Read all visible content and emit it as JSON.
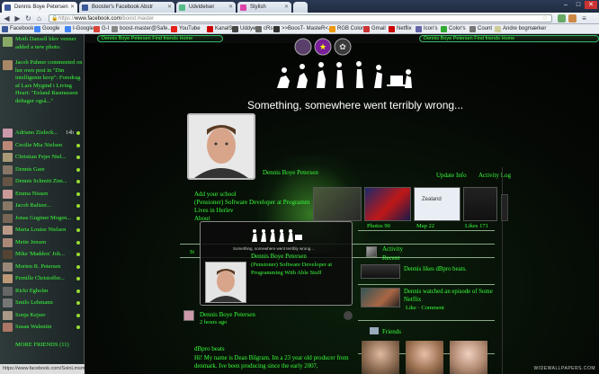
{
  "browser": {
    "tabs": [
      {
        "label": "Dennis Boye Petersen",
        "active": true,
        "favicon_color": "#3b5998"
      },
      {
        "label": "Booster's Facebook Abstr",
        "active": false,
        "favicon_color": "#3b5998"
      },
      {
        "label": "Udvidelser",
        "active": false,
        "favicon_color": "#5b8"
      },
      {
        "label": "Stylish",
        "active": false,
        "favicon_color": "#d4a"
      }
    ],
    "window_buttons": [
      "–",
      "□",
      "✕"
    ],
    "url_scheme": "https://",
    "url_host": "www.facebook.com",
    "url_path": "/boost.master",
    "bookmarks": [
      {
        "label": "Facebook",
        "color": "#3b5998"
      },
      {
        "label": "Google",
        "color": "#4285f4"
      },
      {
        "label": "I-Google",
        "color": "#4285f4"
      },
      {
        "label": "G-I",
        "color": "#db4437"
      },
      {
        "label": "boost-master@Safe...",
        "color": "#888"
      },
      {
        "label": "YouTube",
        "color": "#e62117"
      },
      {
        "label": "KanalS",
        "color": "#c00"
      },
      {
        "label": "Uddye",
        "color": "#444"
      },
      {
        "label": "cRs",
        "color": "#666"
      },
      {
        "label": ">>BoosT- MasteR<...",
        "color": "#333"
      },
      {
        "label": "RGB Color",
        "color": "#e91"
      },
      {
        "label": "Gmail",
        "color": "#c33"
      },
      {
        "label": "Netflix",
        "color": "#c00"
      },
      {
        "label": "Icon's",
        "color": "#66a"
      },
      {
        "label": "Color's",
        "color": "#3a3"
      },
      {
        "label": "Count",
        "color": "#777"
      },
      {
        "label": "Andre bogmærker",
        "color": "#cc9"
      }
    ]
  },
  "sidebar": {
    "notifications": [
      {
        "text": "Moth Dansell blev venner added a new photo.",
        "avatar_color": "#8a6"
      },
      {
        "text": "Jacob Pahner commented on her own post in \"Din intelligente krop\": Foredrag af Lars Mygind i Living Heart: \"Eeland Rasmussen deltager også...\"",
        "avatar_color": "#a86"
      }
    ],
    "friends": [
      {
        "name": "Adriano Zieleck...",
        "meta": "14h",
        "avatar_color": "#c9a"
      },
      {
        "name": "Cecilie Mia Nielsen",
        "meta": "",
        "avatar_color": "#b87"
      },
      {
        "name": "Christian Fejer Niel...",
        "meta": "",
        "avatar_color": "#a97"
      },
      {
        "name": "Dennis Gare",
        "meta": "",
        "avatar_color": "#876"
      },
      {
        "name": "Dennis Schmitt Zim...",
        "meta": "",
        "avatar_color": "#654"
      },
      {
        "name": "Emma Nissen",
        "meta": "",
        "avatar_color": "#c99"
      },
      {
        "name": "Jacob Baltzer...",
        "meta": "",
        "avatar_color": "#876"
      },
      {
        "name": "Jonas Guginer Mogen...",
        "meta": "",
        "avatar_color": "#765"
      },
      {
        "name": "Maria Louise Nielsen",
        "meta": "",
        "avatar_color": "#b98"
      },
      {
        "name": "Mette Jensen",
        "meta": "",
        "avatar_color": "#a87"
      },
      {
        "name": "Mike 'Maddox' Joh...",
        "meta": "",
        "avatar_color": "#543"
      },
      {
        "name": "Morten R. Petersen",
        "meta": "",
        "avatar_color": "#987"
      },
      {
        "name": "Pernille Christoffer...",
        "meta": "",
        "avatar_color": "#b97"
      },
      {
        "name": "Ricki Egholm",
        "meta": "",
        "avatar_color": "#666"
      },
      {
        "name": "Smilo Lehmann",
        "meta": "",
        "avatar_color": "#777"
      },
      {
        "name": "Sonja Kejser",
        "meta": "",
        "avatar_color": "#a98"
      },
      {
        "name": "Susan Walentin",
        "meta": "",
        "avatar_color": "#a76"
      }
    ],
    "more_friends": "MORE FRIENDS (11)",
    "footer_status": "https://www.facebook.com/SoinLmsme"
  },
  "header": {
    "pills": [
      "Dennis Boye Petersen  Find friends  Home",
      "Dennis Boye Petersen   Find friends   Home"
    ],
    "banner_text": "Something, somewhere went terribly wrong..."
  },
  "profile": {
    "name": "Dennis Boye Petersen",
    "tabs": [
      "Update Info",
      "Activity Log"
    ],
    "info": [
      "Add your school",
      "(Pensioner) Software Developer at Programm",
      "Lives in Herlev",
      "About"
    ],
    "photo_labels": [
      "Photos 90",
      "Map 22",
      "Likes 171"
    ],
    "map_label": "Zealand"
  },
  "popup": {
    "banner": "Something, somewhere went terribly wrong...",
    "name": "Dennis Boye Petersen",
    "job": "(Pensioner) Software Developer at Programming With Able Stuff"
  },
  "post": {
    "author": "Dennis Boye Petersen",
    "time": "2 hours ago",
    "title": "dBpro beats",
    "body": "Hi! My name is Dean Bilgram. Im a 23 year old producer from denmark. Ive been producing since the early 2007,"
  },
  "activity": {
    "heading": "Activity",
    "subheading": "Recent",
    "items": [
      "Dennis likes dBpro beats.",
      "Dennis watched an episode of Some Netflix",
      "Like · Comment"
    ],
    "friends_heading": "Friends"
  },
  "watermark": "WIDEWALLPAPERS.COM"
}
